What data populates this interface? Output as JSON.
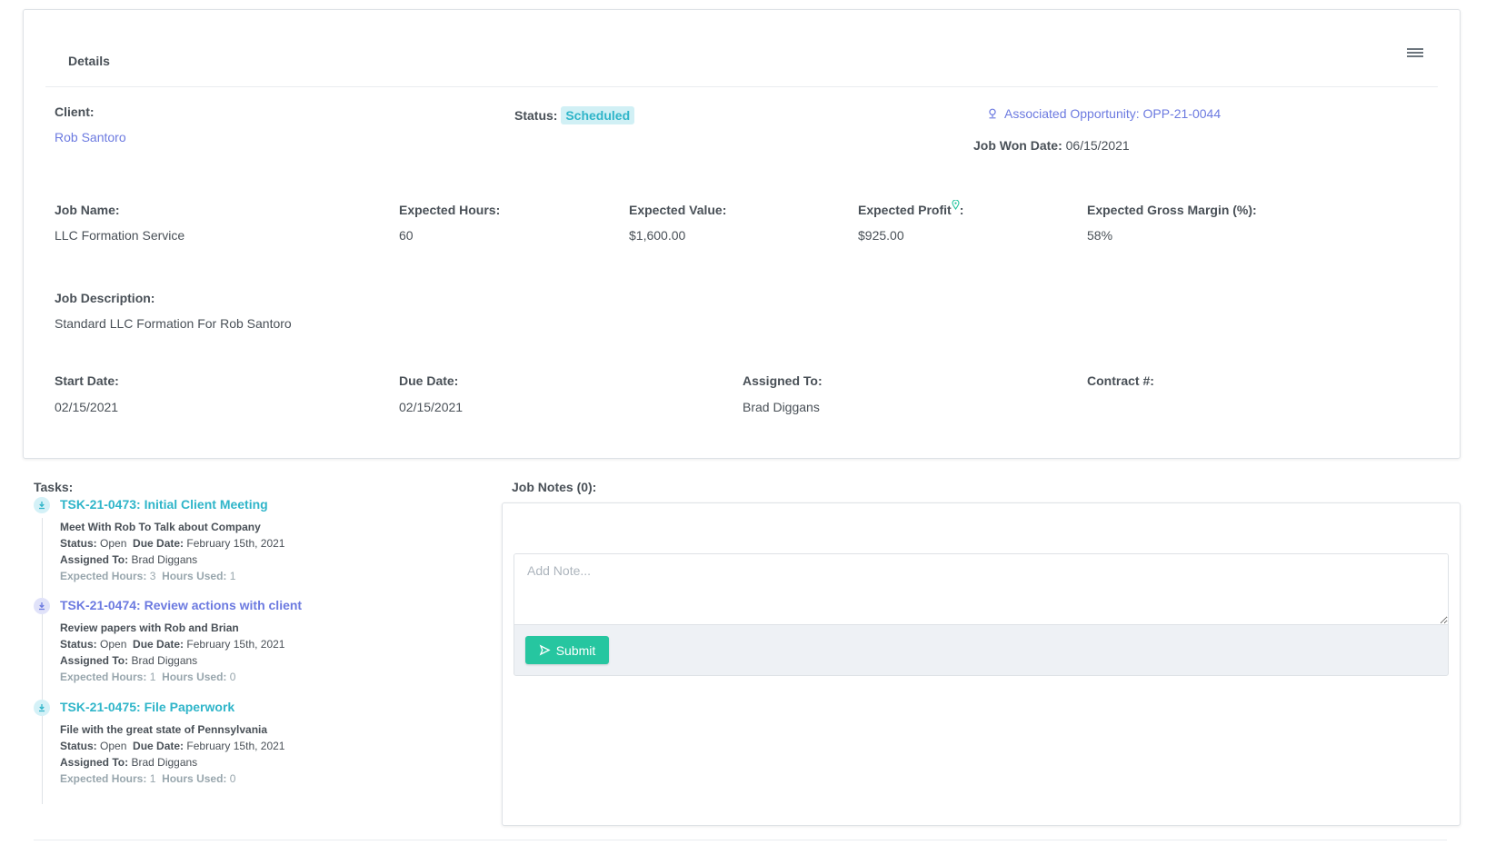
{
  "details": {
    "title": "Details",
    "menu_icon": "hamburger-menu-icon",
    "client_label": "Client:",
    "client_value": "Rob Santoro",
    "status_label": "Status:",
    "status_value": "Scheduled",
    "opportunity_icon": "opportunity-icon",
    "opportunity_label": "Associated Opportunity: OPP-21-0044",
    "job_won_label": "Job Won Date:",
    "job_won_value": "06/15/2021",
    "job_name_label": "Job Name:",
    "job_name_value": "LLC Formation Service",
    "expected_hours_label": "Expected Hours:",
    "expected_hours_value": "60",
    "expected_value_label": "Expected Value:",
    "expected_value_value": "$1,600.00",
    "expected_profit_label": "Expected Profit",
    "expected_profit_colon": ":",
    "expected_profit_value": "$925.00",
    "gross_margin_label": "Expected Gross Margin (%):",
    "gross_margin_value": "58%",
    "description_label": "Job Description:",
    "description_value": "Standard LLC Formation For Rob Santoro",
    "start_date_label": "Start Date:",
    "start_date_value": "02/15/2021",
    "due_date_label": "Due Date:",
    "due_date_value": "02/15/2021",
    "assigned_label": "Assigned To:",
    "assigned_value": "Brad Diggans",
    "contract_label": "Contract #:",
    "contract_value": ""
  },
  "tasks": {
    "title": "Tasks:",
    "labels": {
      "status": "Status:",
      "due_date": "Due Date:",
      "assigned_to": "Assigned To:",
      "expected_hours": "Expected Hours:",
      "hours_used": "Hours Used:"
    },
    "items": [
      {
        "title": "TSK-21-0473: Initial Client Meeting",
        "description": "Meet With Rob To Talk about Company",
        "status": "Open",
        "due_date": "February 15th, 2021",
        "assigned_to": "Brad Diggans",
        "expected_hours": "3",
        "hours_used": "1",
        "color": "#2fb5c9"
      },
      {
        "title": "TSK-21-0474: Review actions with client",
        "description": "Review papers with Rob and Brian",
        "status": "Open",
        "due_date": "February 15th, 2021",
        "assigned_to": "Brad Diggans",
        "expected_hours": "1",
        "hours_used": "0",
        "color": "#6c7ae0"
      },
      {
        "title": "TSK-21-0475: File Paperwork",
        "description": "File with the great state of Pennsylvania",
        "status": "Open",
        "due_date": "February 15th, 2021",
        "assigned_to": "Brad Diggans",
        "expected_hours": "1",
        "hours_used": "0",
        "color": "#2fb5c9"
      }
    ]
  },
  "notes": {
    "title": "Job Notes (0):",
    "placeholder": "Add Note...",
    "submit_label": "Submit",
    "submit_icon": "send-icon"
  },
  "colors": {
    "link": "#6c7ae0",
    "teal": "#2fb5c9",
    "submit": "#26c6a0",
    "badge_bg": "#d1f0f5"
  }
}
